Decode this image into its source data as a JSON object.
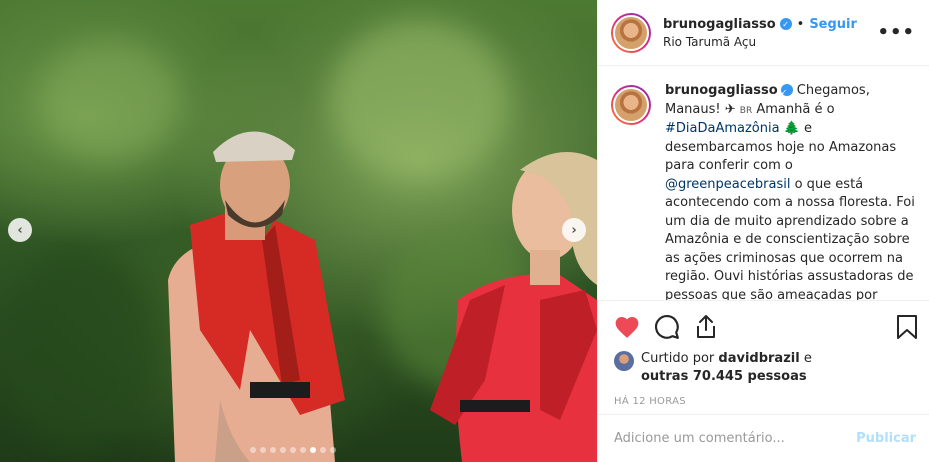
{
  "post": {
    "author": "brunogagliasso",
    "verified_mark": "✓",
    "separator": "•",
    "follow_label": "Seguir",
    "location": "Rio Tarumã Açu",
    "more_label": "•••"
  },
  "caption": {
    "author": "brunogagliasso",
    "part1": " Chegamos, Manaus! ",
    "part2": " Amanhã é o ",
    "hashtag": "#DiaDaAmazônia",
    "part3": " e desembarcamos hoje no Amazonas para conferir com o ",
    "mention": "@greenpeacebrasil",
    "part4": " o que está acontecendo com a nossa floresta. Foi um dia de muito aprendizado sobre a Amazônia e de conscientização sobre as ações criminosas que ocorrem na região. Ouvi histórias assustadoras de pessoas que são ameaçadas por",
    "emoji_plane": "✈",
    "emoji_flag": "BR",
    "emoji_tree": "🌲"
  },
  "likes": {
    "prefix": "Curtido por ",
    "user": "davidbrazil",
    "middle": " e ",
    "others": "outras 70.445 pessoas"
  },
  "timestamp": "HÁ 12 HORAS",
  "comment": {
    "placeholder": "Adicione um comentário...",
    "publish_label": "Publicar"
  },
  "carousel": {
    "prev_label": "‹",
    "next_label": "›",
    "slides": 9,
    "active_index": 6
  },
  "colors": {
    "like": "#ed4956",
    "accent": "#3897f0",
    "link": "#003569",
    "publish_disabled": "#b2dffc"
  }
}
